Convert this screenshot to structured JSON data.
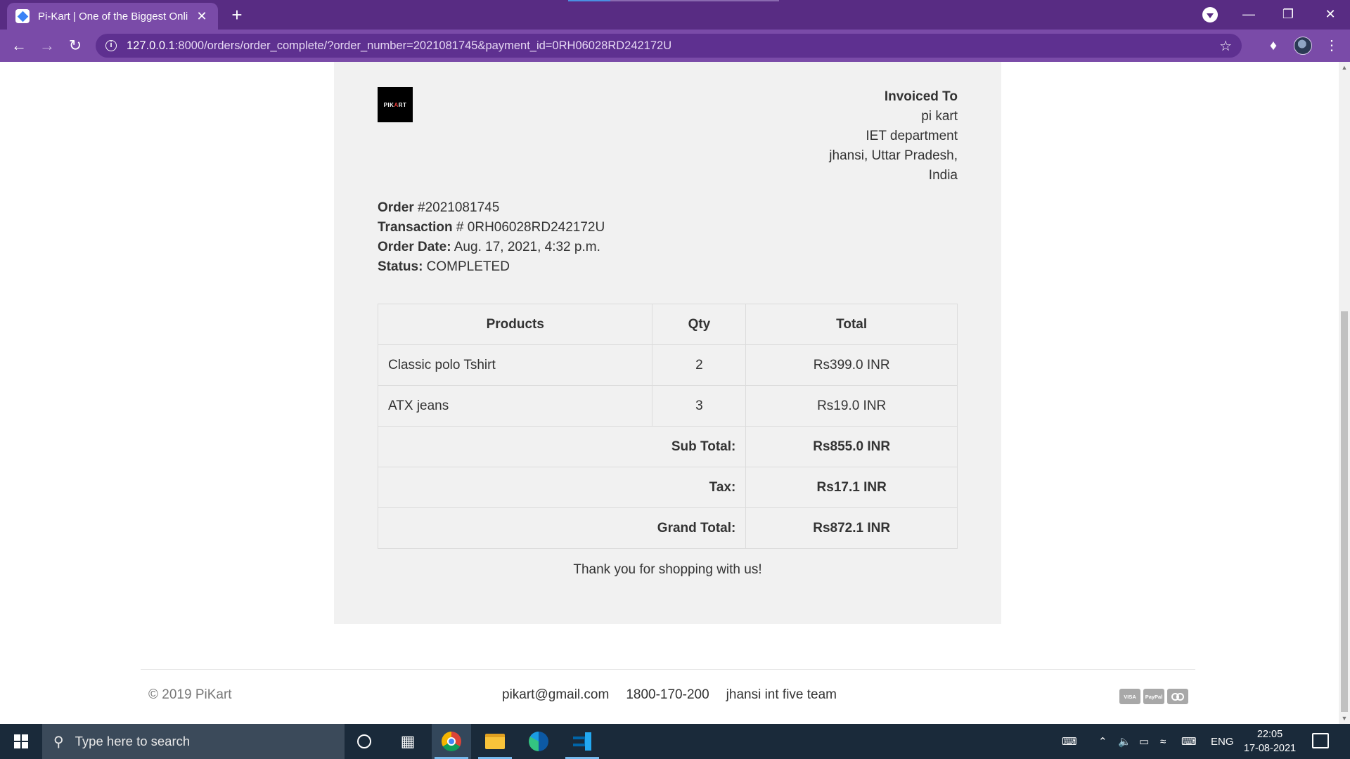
{
  "browser": {
    "tab_title": "Pi-Kart | One of the Biggest Onlin",
    "tab_close": "✕",
    "new_tab": "+",
    "url_host": "127.0.0.1",
    "url_path": ":8000/orders/order_complete/?order_number=2021081745&payment_id=0RH06028RD242172U",
    "icons": [
      "back-icon",
      "forward-icon",
      "reload-icon",
      "info-icon",
      "star-icon",
      "extensions-icon",
      "menu-icon"
    ]
  },
  "invoice": {
    "logo_text_left": "PIK",
    "logo_text_accent": "A",
    "logo_text_right": "RT",
    "invoiced_to_label": "Invoiced To",
    "address_lines": [
      "pi kart",
      "IET department",
      "jhansi, Uttar Pradesh,",
      "India"
    ],
    "order_label": "Order",
    "order_value": " #2021081745",
    "transaction_label": "Transaction",
    "transaction_value": " # 0RH06028RD242172U",
    "order_date_label": "Order Date:",
    "order_date_value": " Aug. 17, 2021, 4:32 p.m.",
    "status_label": "Status:",
    "status_value": " COMPLETED"
  },
  "table": {
    "headers": [
      "Products",
      "Qty",
      "Total"
    ],
    "rows": [
      {
        "product": "Classic polo Tshirt",
        "qty": "2",
        "total": "Rs399.0 INR"
      },
      {
        "product": "ATX jeans",
        "qty": "3",
        "total": "Rs19.0 INR"
      }
    ],
    "sub_total_label": "Sub Total:",
    "sub_total_value": "Rs855.0 INR",
    "tax_label": "Tax:",
    "tax_value": "Rs17.1 INR",
    "grand_total_label": "Grand Total:",
    "grand_total_value": "Rs872.1 INR"
  },
  "thanks": "Thank you for shopping with us!",
  "footer": {
    "copyright": "© 2019 PiKart",
    "email": "pikart@gmail.com",
    "phone": "1800-170-200",
    "team": "jhansi int five team",
    "cards": [
      "VISA",
      "PayPal"
    ]
  },
  "taskbar": {
    "search_placeholder": "Type here to search",
    "language": "ENG",
    "time": "22:05",
    "date": "17-08-2021"
  },
  "colors": {
    "chrome_dark": "#582c83",
    "chrome_light": "#7a4ba8",
    "invoice_bg": "#f1f1f1",
    "taskbar_bg": "#1a2a3a"
  }
}
